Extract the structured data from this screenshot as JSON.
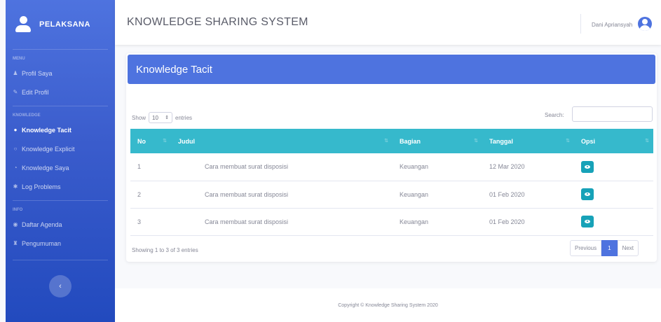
{
  "sidebar": {
    "brand": "PELAKSANA",
    "sections": [
      {
        "heading": "MENU",
        "items": [
          {
            "icon": "user-icon",
            "label": "Profil Saya"
          },
          {
            "icon": "user-edit-icon",
            "label": "Edit Profil"
          }
        ]
      },
      {
        "heading": "KNOWLEDGE",
        "items": [
          {
            "icon": "lightbulb-icon",
            "label": "Knowledge Tacit",
            "active": true
          },
          {
            "icon": "lightbulb-outline-icon",
            "label": "Knowledge Explicit"
          },
          {
            "icon": "circle-arrow-icon",
            "label": "Knowledge Saya"
          },
          {
            "icon": "gear-icon",
            "label": "Log Problems"
          }
        ]
      },
      {
        "heading": "INFO",
        "items": [
          {
            "icon": "calendar-icon",
            "label": "Daftar Agenda"
          },
          {
            "icon": "megaphone-icon",
            "label": "Pengumuman"
          }
        ]
      }
    ],
    "toggle_icon": "chevron-left-icon"
  },
  "topbar": {
    "title": "KNOWLEDGE SHARING SYSTEM",
    "user_name": "Dani Apriansyah",
    "avatar_icon": "user-circle-icon"
  },
  "card": {
    "header": "Knowledge Tacit",
    "show_label": "Show",
    "entries_value": "10",
    "entries_label": "entries",
    "search_label": "Search:",
    "search_value": "",
    "columns": [
      "No",
      "Judul",
      "Bagian",
      "Tanggal",
      "Opsi"
    ],
    "rows": [
      {
        "no": "1",
        "judul": "Cara membuat surat disposisi",
        "bagian": "Keuangan",
        "tanggal": "12 Mar 2020"
      },
      {
        "no": "2",
        "judul": "Cara membuat surat disposisi",
        "bagian": "Keuangan",
        "tanggal": "01 Feb 2020"
      },
      {
        "no": "3",
        "judul": "Cara membuat surat disposisi",
        "bagian": "Keuangan",
        "tanggal": "01 Feb 2020"
      }
    ],
    "info": "Showing 1 to 3 of 3 entries",
    "pagination": {
      "previous": "Previous",
      "current": "1",
      "next": "Next"
    }
  },
  "footer": {
    "text": "Copyright © Knowledge Sharing System 2020"
  },
  "colors": {
    "primary": "#4e73df",
    "table_header": "#36b9cc",
    "action_button": "#17a2b8"
  }
}
